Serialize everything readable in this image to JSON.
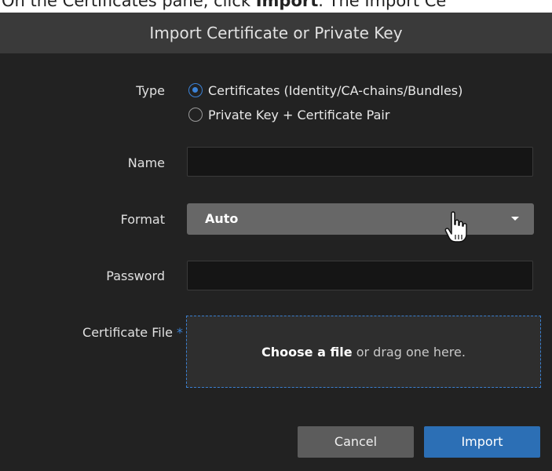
{
  "caption": {
    "prefix": "On the Certificates pane, click ",
    "bold": "Import",
    "suffix": ". The Import Ce"
  },
  "dialog": {
    "title": "Import Certificate or Private Key",
    "type": {
      "label": "Type",
      "options": [
        {
          "label": "Certificates (Identity/CA-chains/Bundles)",
          "checked": true
        },
        {
          "label": "Private Key + Certificate Pair",
          "checked": false
        }
      ]
    },
    "name": {
      "label": "Name",
      "value": ""
    },
    "format": {
      "label": "Format",
      "value": "Auto"
    },
    "password": {
      "label": "Password",
      "value": ""
    },
    "certificate_file": {
      "label": "Certificate File",
      "required_marker": "*",
      "choose_text": "Choose a file",
      "drag_text": " or drag one here."
    },
    "buttons": {
      "cancel": "Cancel",
      "import": "Import"
    }
  },
  "colors": {
    "accent": "#3b82d6",
    "dialog_bg": "#222222",
    "header_bg": "#3a3a3a",
    "primary_button": "#2c6fb5",
    "secondary_button": "#5c5c5c"
  },
  "icons": {
    "cursor": "hand-pointer-icon",
    "dropdown": "caret-down-icon"
  }
}
